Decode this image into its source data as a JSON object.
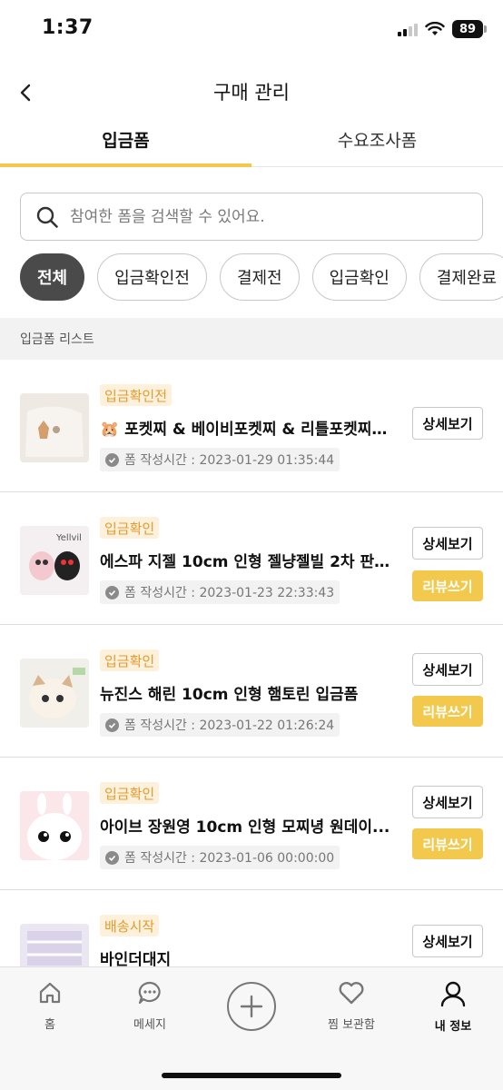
{
  "status_bar": {
    "time": "1:37",
    "battery": "89"
  },
  "header": {
    "title": "구매 관리"
  },
  "tabs": [
    {
      "label": "입금폼",
      "active": true
    },
    {
      "label": "수요조사폼",
      "active": false
    }
  ],
  "search": {
    "placeholder": "참여한 폼을 검색할 수 있어요."
  },
  "filters": [
    {
      "label": "전체",
      "active": true
    },
    {
      "label": "입금확인전",
      "active": false
    },
    {
      "label": "결제전",
      "active": false
    },
    {
      "label": "입금확인",
      "active": false
    },
    {
      "label": "결제완료",
      "active": false
    }
  ],
  "section": {
    "title": "입금폼 리스트"
  },
  "items": [
    {
      "status": "입금확인전",
      "title": "🐹 포켓찌 & 베이비포켓찌 & 리틀포켓찌 ...",
      "time": "폼 작성시간 : 2023-01-29 01:35:44",
      "detail_label": "상세보기",
      "review_label": ""
    },
    {
      "status": "입금확인",
      "title": "에스파 지젤 10cm 인형 젤냥젤빌 2차 판...",
      "time": "폼 작성시간 : 2023-01-23 22:33:43",
      "detail_label": "상세보기",
      "review_label": "리뷰쓰기"
    },
    {
      "status": "입금확인",
      "title": "뉴진스 해린 10cm 인형 햄토린 입금폼",
      "time": "폼 작성시간 : 2023-01-22 01:26:24",
      "detail_label": "상세보기",
      "review_label": "리뷰쓰기"
    },
    {
      "status": "입금확인",
      "title": "아이브 장원영 10cm 인형 모찌녕 원데이...",
      "time": "폼 작성시간 : 2023-01-06 00:00:00",
      "detail_label": "상세보기",
      "review_label": "리뷰쓰기"
    },
    {
      "status": "배송시작",
      "title": "바인더대지",
      "time": "",
      "detail_label": "상세보기",
      "review_label": ""
    }
  ],
  "bottom_nav": {
    "home": "홈",
    "message": "메세지",
    "saved": "찜 보관함",
    "my": "내 정보"
  },
  "colors": {
    "accent": "#f2c94c",
    "status_text": "#e39b2f",
    "status_bg": "#fdf1dc"
  }
}
